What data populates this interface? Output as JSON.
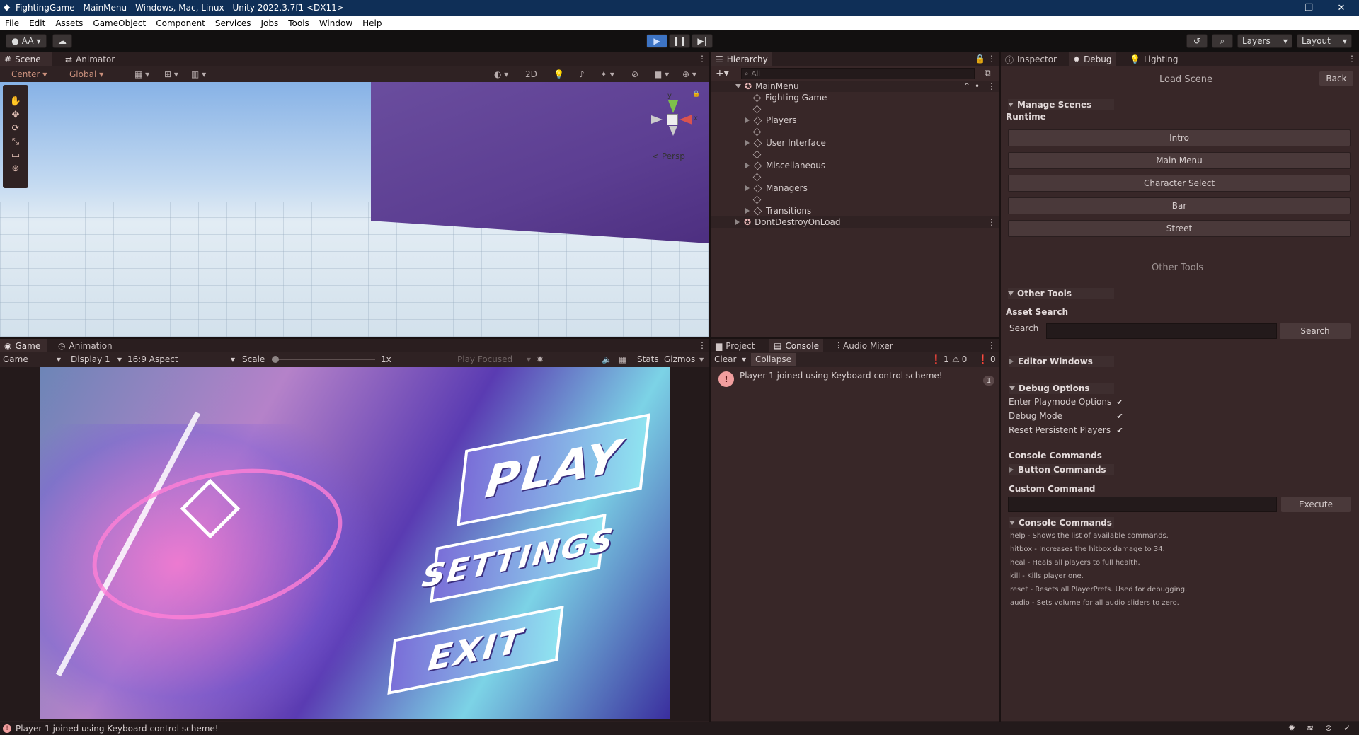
{
  "window": {
    "title": "FightingGame - MainMenu - Windows, Mac, Linux - Unity 2022.3.7f1 <DX11>",
    "controls": [
      "—",
      "❐",
      "✕"
    ]
  },
  "menubar": [
    "File",
    "Edit",
    "Assets",
    "GameObject",
    "Component",
    "Services",
    "Jobs",
    "Tools",
    "Window",
    "Help"
  ],
  "toolbar": {
    "account": "AA",
    "layers": "Layers",
    "layout": "Layout"
  },
  "scene_panel": {
    "tabs": [
      "Scene",
      "Animator"
    ],
    "pivot": "Center",
    "space": "Global",
    "mode_2d": "2D",
    "gizmo_persp": "< Persp",
    "axis_y": "y",
    "axis_x": "x"
  },
  "game_panel": {
    "tabs": [
      "Game",
      "Animation"
    ],
    "game_dropdown": "Game",
    "display": "Display 1",
    "aspect": "16:9 Aspect",
    "scale_label": "Scale",
    "scale_value": "1x",
    "play_focused": "Play Focused",
    "stats": "Stats",
    "gizmos": "Gizmos",
    "menu": {
      "play": "PLAY",
      "settings": "SETTINGS",
      "exit": "EXIT"
    }
  },
  "hierarchy": {
    "tab": "Hierarchy",
    "search_placeholder": "All",
    "scene": "MainMenu",
    "items": [
      "Fighting Game",
      "Players",
      "User Interface",
      "Miscellaneous",
      "Managers",
      "Transitions"
    ],
    "dont_destroy": "DontDestroyOnLoad"
  },
  "console": {
    "tabs": [
      "Project",
      "Console",
      "Audio Mixer"
    ],
    "clear": "Clear",
    "collapse": "Collapse",
    "counts": {
      "errors": "1",
      "warnings": "0",
      "info": "0"
    },
    "message": "Player 1 joined using Keyboard control scheme!",
    "message_count": "1"
  },
  "inspector": {
    "tabs": [
      "Inspector",
      "Debug",
      "Lighting"
    ],
    "load_scene_title": "Load Scene",
    "back": "Back",
    "manage_scenes": "Manage Scenes",
    "runtime": "Runtime",
    "scenes": [
      "Intro",
      "Main Menu",
      "Character Select",
      "Bar",
      "Street"
    ],
    "other_tools_title": "Other Tools",
    "other_tools": "Other Tools",
    "asset_search": "Asset Search",
    "search_label": "Search",
    "search_button": "Search",
    "editor_windows": "Editor Windows",
    "debug_options": "Debug Options",
    "options": [
      "Enter Playmode Options",
      "Debug Mode",
      "Reset Persistent Players"
    ],
    "console_commands_label": "Console Commands",
    "button_commands": "Button Commands",
    "custom_command": "Custom Command",
    "execute": "Execute",
    "console_commands_foldout": "Console Commands",
    "commands": [
      "help - Shows the list of available commands.",
      "hitbox - Increases the hitbox damage to 34.",
      "heal - Heals all players to full health.",
      "kill - Kills player one.",
      "reset - Resets all PlayerPrefs. Used for debugging.",
      "audio - Sets volume for all audio sliders to zero."
    ]
  },
  "status": "Player 1 joined using Keyboard control scheme!",
  "colors": {
    "accent": "#3d74c4",
    "panel": "#382728",
    "button": "#4a393a"
  }
}
